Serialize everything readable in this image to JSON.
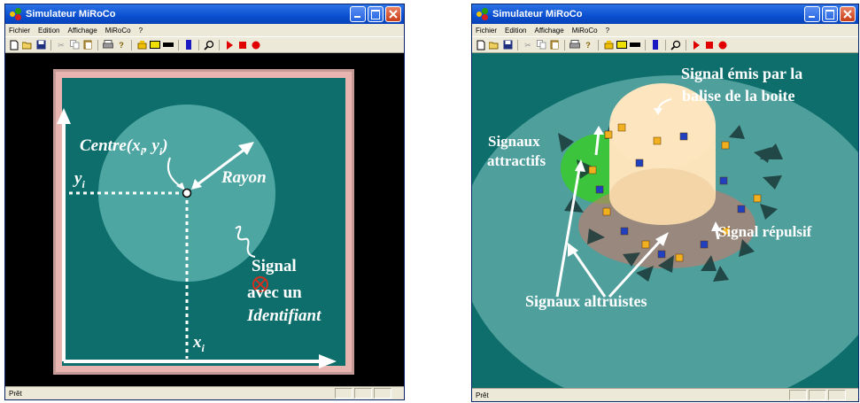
{
  "left_window": {
    "title": "Simulateur MiRoCo",
    "menu": [
      "Fichier",
      "Edition",
      "Affichage",
      "MiRoCo",
      "?"
    ],
    "status": "Prêt",
    "annotations": {
      "centre": "Centre(x",
      "centre_sub_i": "i",
      "centre_mid": ", y",
      "centre_sub_i2": "i",
      "centre_end": ")",
      "yi": "y",
      "yi_sub": "i",
      "rayon": "Rayon",
      "signal": "Signal",
      "avec_un": "avec un",
      "identifiant": "Identifiant",
      "xi": "x",
      "xi_sub": "i"
    }
  },
  "right_window": {
    "title": "Simulateur MiRoCo",
    "menu": [
      "Fichier",
      "Edition",
      "Affichage",
      "MiRoCo",
      "?"
    ],
    "status": "Prêt",
    "annotations": {
      "signal_emis_1": "Signal émis par la",
      "signal_emis_2": "balise de la boite",
      "signaux": "Signaux",
      "attractifs": "attractifs",
      "signal_repulsif": "Signal répulsif",
      "signaux_altruistes": "Signaux altruistes"
    }
  },
  "colors": {
    "arena_teal": "#0d6e6b",
    "arena_light": "#4f9f9c",
    "circle_light": "#4da6a2",
    "wall_pink": "#e8b4b0",
    "title_blue": "#0a4fd0",
    "attract_green": "#3cc43c",
    "box_cream": "#fde6bf"
  }
}
